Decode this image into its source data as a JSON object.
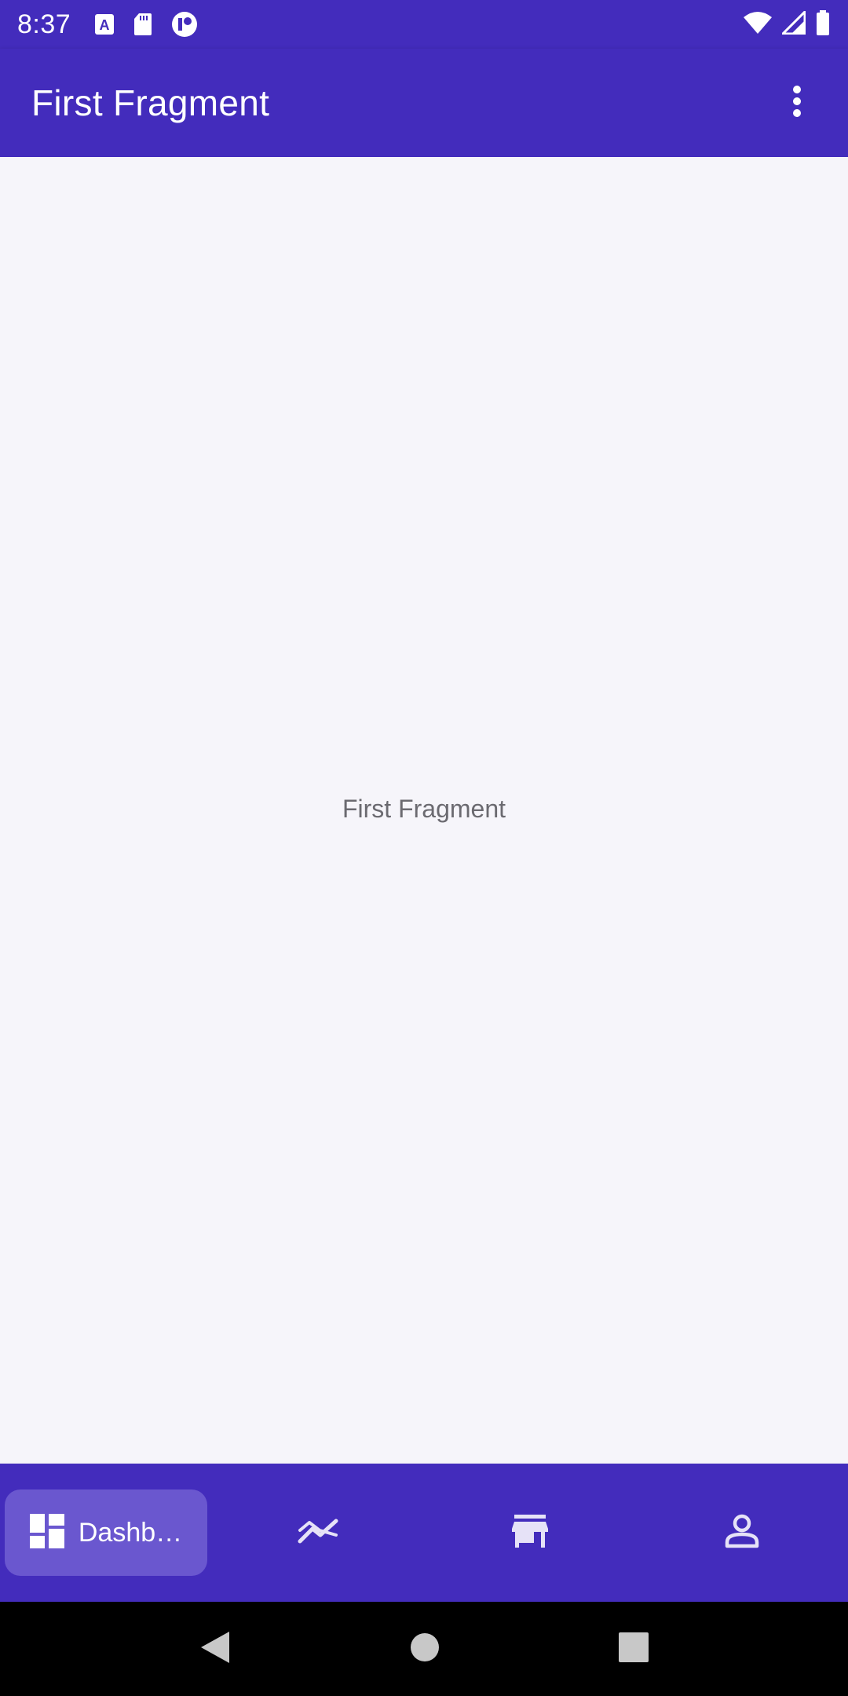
{
  "status_bar": {
    "time": "8:37",
    "icons_left": [
      "accessibility-a-icon",
      "sd-card-icon",
      "app-notification-icon"
    ],
    "icons_right": [
      "wifi-icon",
      "cell-signal-icon",
      "battery-icon"
    ]
  },
  "app_bar": {
    "title": "First Fragment",
    "menu_icon": "more-vert-icon"
  },
  "content": {
    "center_text": "First Fragment"
  },
  "bottom_nav": {
    "items": [
      {
        "label": "Dashb…",
        "icon": "dashboard-icon",
        "selected": true
      },
      {
        "label": "",
        "icon": "trending-icon",
        "selected": false
      },
      {
        "label": "",
        "icon": "store-icon",
        "selected": false
      },
      {
        "label": "",
        "icon": "person-icon",
        "selected": false
      }
    ]
  },
  "system_nav": {
    "buttons": [
      "back",
      "home",
      "recents"
    ]
  },
  "colors": {
    "primary": "#432cbc",
    "selected_pill": "#6a57cf",
    "background": "#f6f5fa",
    "content_text": "#6b6a70"
  }
}
